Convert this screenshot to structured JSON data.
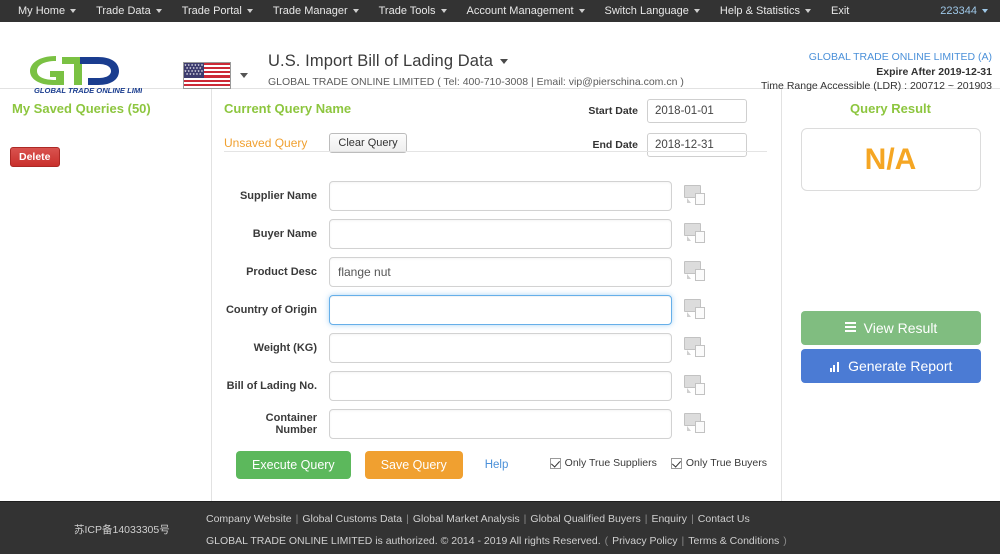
{
  "topnav": {
    "items": [
      {
        "label": "My Home",
        "caret": true
      },
      {
        "label": "Trade Data",
        "caret": true
      },
      {
        "label": "Trade Portal",
        "caret": true
      },
      {
        "label": "Trade Manager",
        "caret": true
      },
      {
        "label": "Trade Tools",
        "caret": true
      },
      {
        "label": "Account Management",
        "caret": true
      },
      {
        "label": "Switch Language",
        "caret": true
      },
      {
        "label": "Help & Statistics",
        "caret": true
      },
      {
        "label": "Exit",
        "caret": false
      }
    ],
    "user_id": "223344"
  },
  "header": {
    "logo_text": "GLOBAL TRADE  ONLINE LIMITED",
    "flag_country": "United States",
    "page_title": "U.S. Import Bill of Lading Data",
    "subtitle": "GLOBAL TRADE ONLINE LIMITED ( Tel: 400-710-3008 | Email: vip@pierschina.com.cn )",
    "account_name": "GLOBAL TRADE ONLINE LIMITED (A)",
    "expire": "Expire After 2019-12-31",
    "time_range": "Time Range Accessible (LDR) : 200712 ~ 201903"
  },
  "sidebar": {
    "saved_queries_title": "My Saved Queries (50)",
    "delete_label": "Delete"
  },
  "query_panel": {
    "current_query_name_label": "Current Query Name",
    "unsaved_label": "Unsaved Query",
    "clear_query_label": "Clear Query",
    "start_date_label": "Start Date",
    "start_date_value": "2018-01-01",
    "end_date_label": "End Date",
    "end_date_value": "2018-12-31",
    "fields": [
      {
        "label": "Supplier Name",
        "value": "",
        "focused": false,
        "icon": "comment-icon"
      },
      {
        "label": "Buyer Name",
        "value": "",
        "focused": false,
        "icon": "comment-icon"
      },
      {
        "label": "Product Desc",
        "value": "flange nut",
        "focused": false,
        "icon": "comment-icon"
      },
      {
        "label": "Country of Origin",
        "value": "",
        "focused": true,
        "icon": "comment-icon"
      },
      {
        "label": "Weight (KG)",
        "value": "",
        "focused": false,
        "icon": "comment-icon"
      },
      {
        "label": "Bill of Lading No.",
        "value": "",
        "focused": false,
        "icon": "comment-icon"
      },
      {
        "label": "Container Number",
        "value": "",
        "focused": false,
        "icon": "comment-icon"
      }
    ],
    "execute_label": "Execute Query",
    "save_label": "Save Query",
    "help_label": "Help",
    "checkboxes": [
      {
        "label": "Only True Suppliers",
        "checked": true
      },
      {
        "label": "Only True Buyers",
        "checked": true
      }
    ]
  },
  "result_panel": {
    "title": "Query Result",
    "value": "N/A",
    "view_result_label": "View Result",
    "generate_report_label": "Generate Report"
  },
  "footer": {
    "icp": "苏ICP备14033305号",
    "links": [
      "Company Website",
      "Global Customs Data",
      "Global Market Analysis",
      "Global Qualified Buyers",
      "Enquiry",
      "Contact Us"
    ],
    "copyright": "GLOBAL TRADE ONLINE LIMITED is authorized. © 2014 - 2019 All rights Reserved.",
    "legal_open": "(",
    "legal_links": [
      "Privacy Policy",
      "Terms & Conditions"
    ],
    "legal_close": ")"
  },
  "colors": {
    "nav_bg": "#333333",
    "brand_green": "#8dc63f",
    "accent_orange": "#f0a030",
    "link_blue": "#4a90d9",
    "result_orange": "#f5a623",
    "danger_red": "#c9302c"
  }
}
